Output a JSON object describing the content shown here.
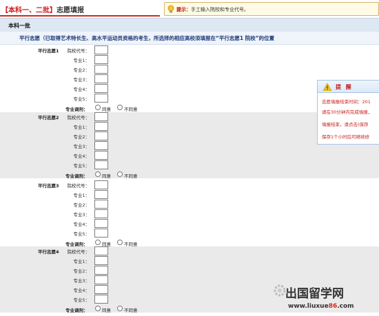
{
  "header": {
    "title_bracket": "【本科一、二批】",
    "title_text": "志愿填报",
    "tip_label": "提示：",
    "tip_text": "手工输入院校和专业代号。"
  },
  "batch": {
    "label": "本科一批",
    "note": "平行志愿（已取得艺术特长生、高水平运动员资格的考生，所选择的相应高校须填报在“平行志愿1 院校”的位置"
  },
  "form": {
    "school_code_label": "院校代号：",
    "majors": [
      "专业1：",
      "专业2：",
      "专业3：",
      "专业4：",
      "专业5："
    ],
    "adjust_label": "专业调剂：",
    "agree": "同意",
    "disagree": "不同意",
    "volunteers": [
      {
        "label": "平行志愿1"
      },
      {
        "label": "平行志愿2"
      },
      {
        "label": "平行志愿3"
      },
      {
        "label": "平行志愿4"
      }
    ]
  },
  "reminder": {
    "title": "提 醒",
    "lines": [
      "志愿填报结束时间：201",
      "请在30分钟内完成填报，",
      "填报结束，请点击(保存",
      "保存1个小时后可继续修"
    ]
  },
  "watermark": {
    "text": "出国留学网",
    "url_prefix": "www.liuxue",
    "url_number": "86",
    "url_suffix": ".com"
  }
}
